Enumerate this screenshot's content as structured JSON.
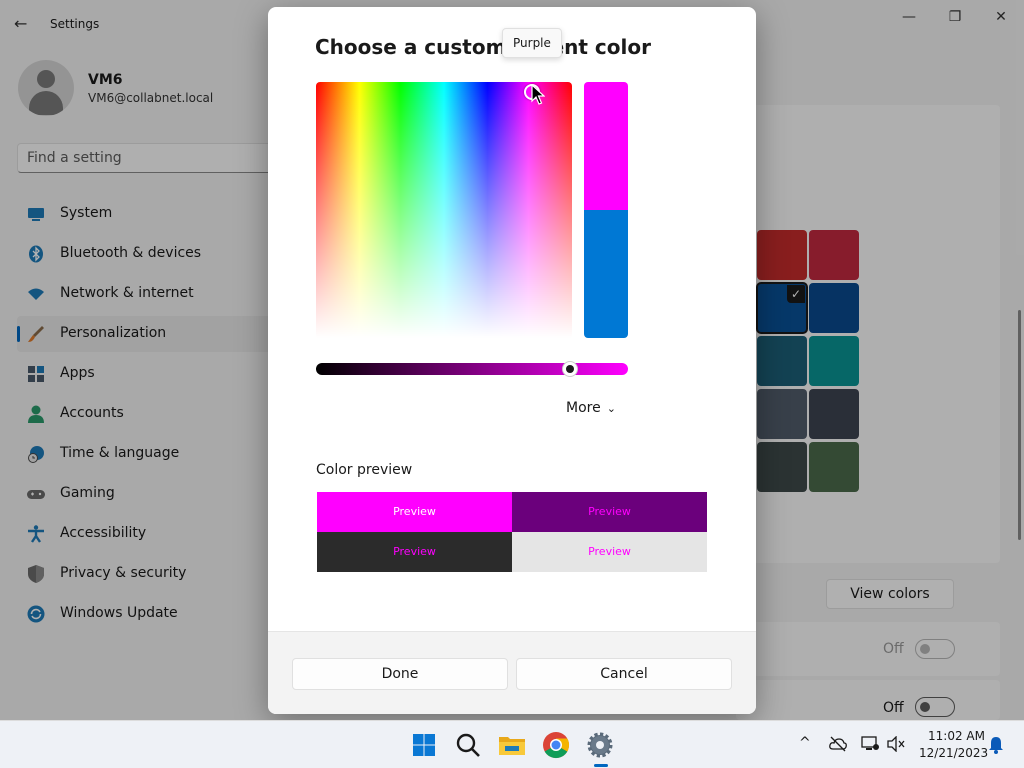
{
  "window": {
    "title": "Settings",
    "back_glyph": "←",
    "minimize_glyph": "—",
    "maximize_glyph": "❐",
    "close_glyph": "✕"
  },
  "profile": {
    "name": "VM6",
    "email": "VM6@collabnet.local"
  },
  "search": {
    "placeholder": "Find a setting"
  },
  "sidebar": {
    "items": [
      {
        "label": "System",
        "icon": "monitor-icon"
      },
      {
        "label": "Bluetooth & devices",
        "icon": "bluetooth-icon"
      },
      {
        "label": "Network & internet",
        "icon": "wifi-icon"
      },
      {
        "label": "Personalization",
        "icon": "brush-icon",
        "selected": true
      },
      {
        "label": "Apps",
        "icon": "apps-icon"
      },
      {
        "label": "Accounts",
        "icon": "person-icon"
      },
      {
        "label": "Time & language",
        "icon": "clock-globe-icon"
      },
      {
        "label": "Gaming",
        "icon": "gamepad-icon"
      },
      {
        "label": "Accessibility",
        "icon": "accessibility-icon"
      },
      {
        "label": "Privacy & security",
        "icon": "shield-icon"
      },
      {
        "label": "Windows Update",
        "icon": "update-icon"
      }
    ]
  },
  "accent_swatches": [
    {
      "color": "#c42b2b"
    },
    {
      "color": "#c2293f"
    },
    {
      "color": "#0a5197",
      "selected": true,
      "check": "✓"
    },
    {
      "color": "#0a4a8f"
    },
    {
      "color": "#1c5f78"
    },
    {
      "color": "#0a9494"
    },
    {
      "color": "#515c6b"
    },
    {
      "color": "#3d4451"
    },
    {
      "color": "#3e4a4a"
    },
    {
      "color": "#4b6a4b"
    }
  ],
  "content": {
    "view_colors_label": "View colors",
    "toggle1_label": "Off",
    "toggle2_label": "Off"
  },
  "dialog": {
    "title": "Choose a custom accent color",
    "tooltip": "Purple",
    "selected_color": "#ff00ff",
    "previous_color": "#0078d4",
    "more_label": "More",
    "more_chevron": "⌄",
    "color_preview_label": "Color preview",
    "preview_text": "Preview",
    "preview_cells": [
      {
        "bg": "#ff00ff",
        "fg": "#ffffff"
      },
      {
        "bg": "#6b007c",
        "fg": "#ff00ff"
      },
      {
        "bg": "#2b2b2b",
        "fg": "#ff00ff"
      },
      {
        "bg": "#e5e5e5",
        "fg": "#ff00ff"
      }
    ],
    "done_label": "Done",
    "cancel_label": "Cancel"
  },
  "taskbar": {
    "apps": [
      "start-icon",
      "search-icon",
      "file-explorer-icon",
      "chrome-icon",
      "settings-icon"
    ],
    "tray": {
      "chevron": "^",
      "time": "11:02 AM",
      "date": "12/21/2023"
    }
  }
}
